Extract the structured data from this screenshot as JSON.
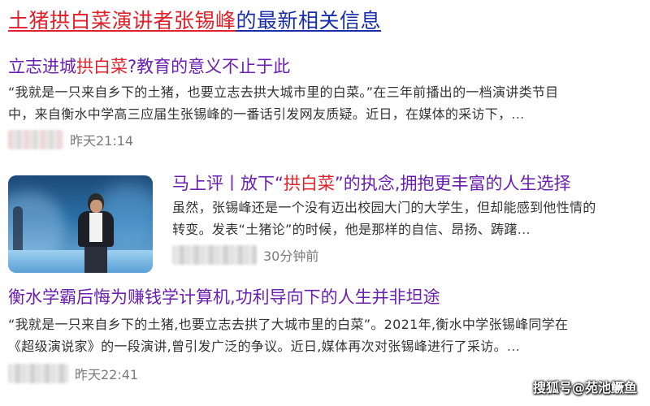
{
  "header": {
    "part1": "土猪拱白菜演讲者张锡峰",
    "part2": "的最新相关信息"
  },
  "results": [
    {
      "title_pre": "立志进城",
      "title_hl": "拱白菜",
      "title_post": "?教育的意义不止于此",
      "snippet_line1": "“我就是一只来自乡下的土猪，也要立志去拱大城市里的白菜。”在三年前播出的一档演讲类节目",
      "snippet_line2": "中，来自衡水中学高三应届生张锡峰的一番话引发网友质疑。近日，在媒体的采访下，",
      "ellipsis": "...",
      "time": "昨天21:14"
    },
    {
      "title_pre": "马上评丨放下“",
      "title_hl": "拱白菜",
      "title_post": "”的执念,拥抱更丰富的人生选择",
      "snippet_line1": "虽然，张锡峰还是一个没有迈出校园大门的大学生，但却能感到他性情的",
      "snippet_line2": "转变。发表“土猪论”的时候，他是那样的自信、昂扬、踌躇",
      "ellipsis": "...",
      "time": "30分钟前"
    },
    {
      "title": "衡水学霸后悔为赚钱学计算机,功利导向下的人生并非坦途",
      "snippet_line1": "“我就是一只来自乡下的土猪,也要立志去拱了大城市里的白菜”。2021年,衡水中学张锡峰同学在",
      "snippet_line2": "《超级演说家》的一段演讲,曾引发广泛的争议。近日,媒体再次对张锡峰进行了采访。",
      "ellipsis": "...",
      "time": "昨天22:41"
    }
  ],
  "watermark": "搜狐号@苑池鳜鱼",
  "colors": {
    "highlight_red": "#e0202a",
    "link_blue": "#1a2ea8",
    "title_purple": "#5a1f9e"
  }
}
